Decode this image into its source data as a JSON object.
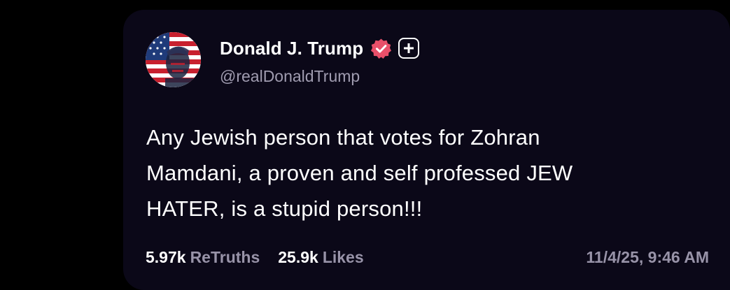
{
  "post": {
    "author": {
      "display_name": "Donald J. Trump",
      "handle": "@realDonaldTrump",
      "verified": true,
      "avatar_icon": "flag-portrait-avatar"
    },
    "text_lines": [
      "Any Jewish person that votes for Zohran",
      "Mamdani, a proven and self professed JEW",
      "HATER, is a stupid person!!!"
    ],
    "stats": {
      "retruths_count": "5.97k",
      "retruths_label": "ReTruths",
      "likes_count": "25.9k",
      "likes_label": "Likes"
    },
    "timestamp": "11/4/25, 9:46 AM",
    "follow_icon": "plus-icon"
  },
  "colors": {
    "background": "#000000",
    "card": "#0b0818",
    "verified_badge": "#e8506a",
    "muted_text": "#9893a8"
  }
}
